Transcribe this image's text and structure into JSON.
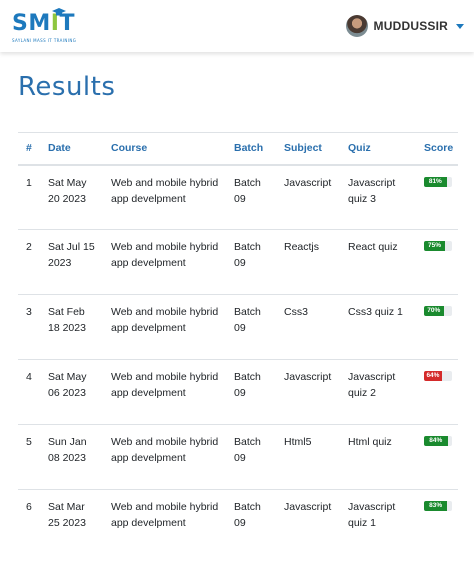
{
  "navbar": {
    "logo_text": "SMIT",
    "logo_tagline": "SAYLANI MASS IT TRAINING",
    "username": "MUDDUSSIR"
  },
  "page_title": "Results",
  "table": {
    "headers": [
      "#",
      "Date",
      "Course",
      "Batch",
      "Subject",
      "Quiz",
      "Score"
    ],
    "rows": [
      {
        "num": "1",
        "date": "Sat May 20 2023",
        "course": "Web and mobile hybrid app develpment",
        "batch": "Batch 09",
        "subject": "Javascript",
        "quiz": "Javascript quiz 3",
        "score_label": "81%",
        "score": 81,
        "color": "#1a8a2e"
      },
      {
        "num": "2",
        "date": "Sat Jul 15 2023",
        "course": "Web and mobile hybrid app develpment",
        "batch": "Batch 09",
        "subject": "Reactjs",
        "quiz": "React quiz",
        "score_label": "75%",
        "score": 75,
        "color": "#1a8a2e"
      },
      {
        "num": "3",
        "date": "Sat Feb 18 2023",
        "course": "Web and mobile hybrid app develpment",
        "batch": "Batch 09",
        "subject": "Css3",
        "quiz": "Css3 quiz 1",
        "score_label": "70%",
        "score": 70,
        "color": "#1a8a2e"
      },
      {
        "num": "4",
        "date": "Sat May 06 2023",
        "course": "Web and mobile hybrid app develpment",
        "batch": "Batch 09",
        "subject": "Javascript",
        "quiz": "Javascript quiz 2",
        "score_label": "64%",
        "score": 64,
        "color": "#d42a2a"
      },
      {
        "num": "5",
        "date": "Sun Jan 08 2023",
        "course": "Web and mobile hybrid app develpment",
        "batch": "Batch 09",
        "subject": "Html5",
        "quiz": "Html quiz",
        "score_label": "84%",
        "score": 84,
        "color": "#1a8a2e"
      },
      {
        "num": "6",
        "date": "Sat Mar 25 2023",
        "course": "Web and mobile hybrid app develpment",
        "batch": "Batch 09",
        "subject": "Javascript",
        "quiz": "Javascript quiz 1",
        "score_label": "83%",
        "score": 83,
        "color": "#1a8a2e"
      }
    ]
  },
  "colors": {
    "primary": "#2a6fad",
    "logo_blue": "#1d79bd",
    "logo_green": "#8dc63f",
    "pass": "#1a8a2e",
    "fail": "#d42a2a"
  }
}
